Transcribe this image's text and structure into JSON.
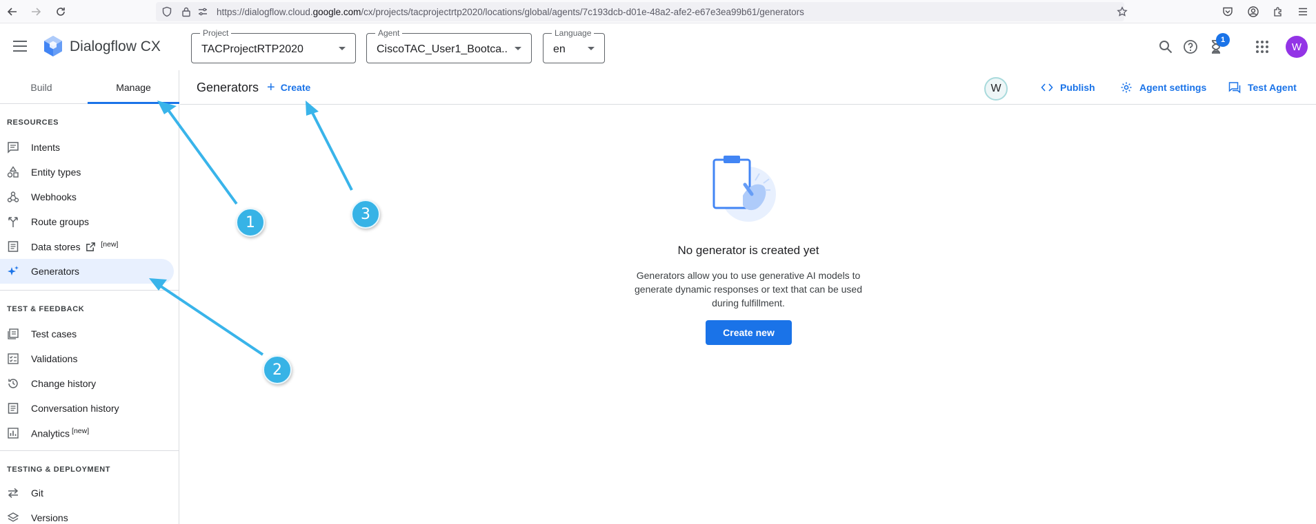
{
  "browser": {
    "url_prefix": "https://dialogflow.cloud.",
    "url_domain": "google.com",
    "url_path": "/cx/projects/tacprojectrtp2020/locations/global/agents/7c193dcb-d01e-48a2-afe2-e67e3ea99b61/generators"
  },
  "header": {
    "app_title": "Dialogflow CX",
    "project": {
      "label": "Project",
      "value": "TACProjectRTP2020"
    },
    "agent": {
      "label": "Agent",
      "value": "CiscoTAC_User1_Bootca..."
    },
    "language": {
      "label": "Language",
      "value": "en"
    },
    "notification_count": "1",
    "avatar_letter": "W"
  },
  "sidebar": {
    "tabs": [
      {
        "label": "Build"
      },
      {
        "label": "Manage"
      }
    ],
    "sections": {
      "resources": "RESOURCES",
      "test_feedback": "TEST & FEEDBACK",
      "testing_deployment": "TESTING & DEPLOYMENT"
    },
    "resources": [
      {
        "label": "Intents",
        "icon": "chat-icon"
      },
      {
        "label": "Entity types",
        "icon": "shapes-icon"
      },
      {
        "label": "Webhooks",
        "icon": "webhook-icon"
      },
      {
        "label": "Route groups",
        "icon": "route-icon"
      },
      {
        "label": "Data stores",
        "icon": "document-icon",
        "badge": "[new]"
      },
      {
        "label": "Generators",
        "icon": "sparkle-icon"
      }
    ],
    "test_feedback": [
      {
        "label": "Test cases",
        "icon": "list-icon"
      },
      {
        "label": "Validations",
        "icon": "checklist-icon"
      },
      {
        "label": "Change history",
        "icon": "history-icon"
      },
      {
        "label": "Conversation history",
        "icon": "document-icon"
      },
      {
        "label": "Analytics",
        "icon": "analytics-icon",
        "badge": "[new]"
      }
    ],
    "testing_deployment": [
      {
        "label": "Git",
        "icon": "swap-icon"
      },
      {
        "label": "Versions",
        "icon": "layers-icon"
      }
    ]
  },
  "toolbar": {
    "title": "Generators",
    "create_label": "Create",
    "user_chip": "W",
    "publish_label": "Publish",
    "agent_settings_label": "Agent settings",
    "test_agent_label": "Test Agent"
  },
  "empty_state": {
    "title": "No generator is created yet",
    "description": "Generators allow you to use generative AI models to generate dynamic responses or text that can be used during fulfillment.",
    "button_label": "Create new"
  },
  "annotations": {
    "markers": [
      "1",
      "2",
      "3"
    ],
    "color": "#37b3e6"
  }
}
